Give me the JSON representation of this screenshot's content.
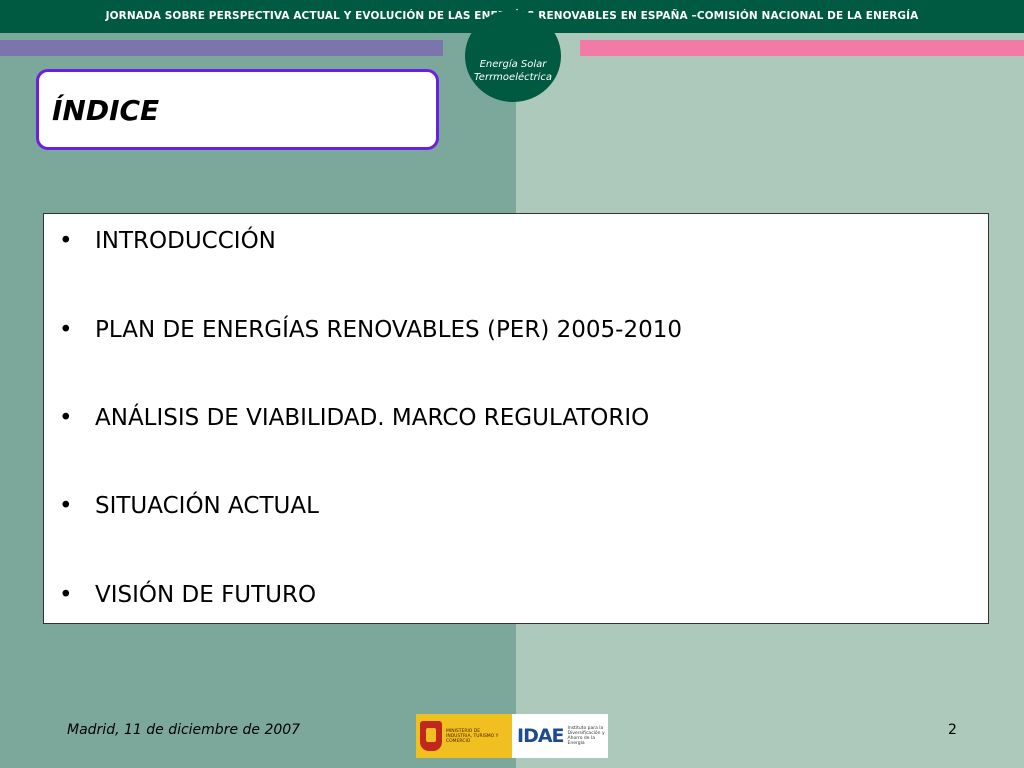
{
  "header": {
    "text": "JORNADA SOBRE PERSPECTIVA ACTUAL Y EVOLUCIÓN DE LAS ENERGÍAS RENOVABLES EN ESPAÑA –COMISIÓN NACIONAL DE LA ENERGÍA"
  },
  "badge": {
    "line1": "Energía Solar",
    "line2": "Terrmoeléctrica"
  },
  "title": "ÍNDICE",
  "bullets": [
    "INTRODUCCIÓN",
    "PLAN DE ENERGÍAS RENOVABLES (PER) 2005-2010",
    "ANÁLISIS DE VIABILIDAD. MARCO REGULATORIO",
    "SITUACIÓN ACTUAL",
    "VISIÓN DE FUTURO"
  ],
  "bullet_symbol": "•",
  "footer": {
    "date": "Madrid, 11 de diciembre de 2007",
    "page_number": "2"
  },
  "logos": {
    "ministry": "MINISTERIO DE INDUSTRIA, TURISMO Y COMERCIO",
    "idae_mark": "IDAE",
    "idae_text": "Instituto para la Diversificación y Ahorro de la Energía"
  },
  "colors": {
    "header_green": "#005941",
    "bg_left": "#7ba89b",
    "bg_right": "#acc9bc",
    "stripe_purple": "#7b74ad",
    "stripe_pink": "#f27aa6",
    "title_border": "#6a20e0"
  }
}
